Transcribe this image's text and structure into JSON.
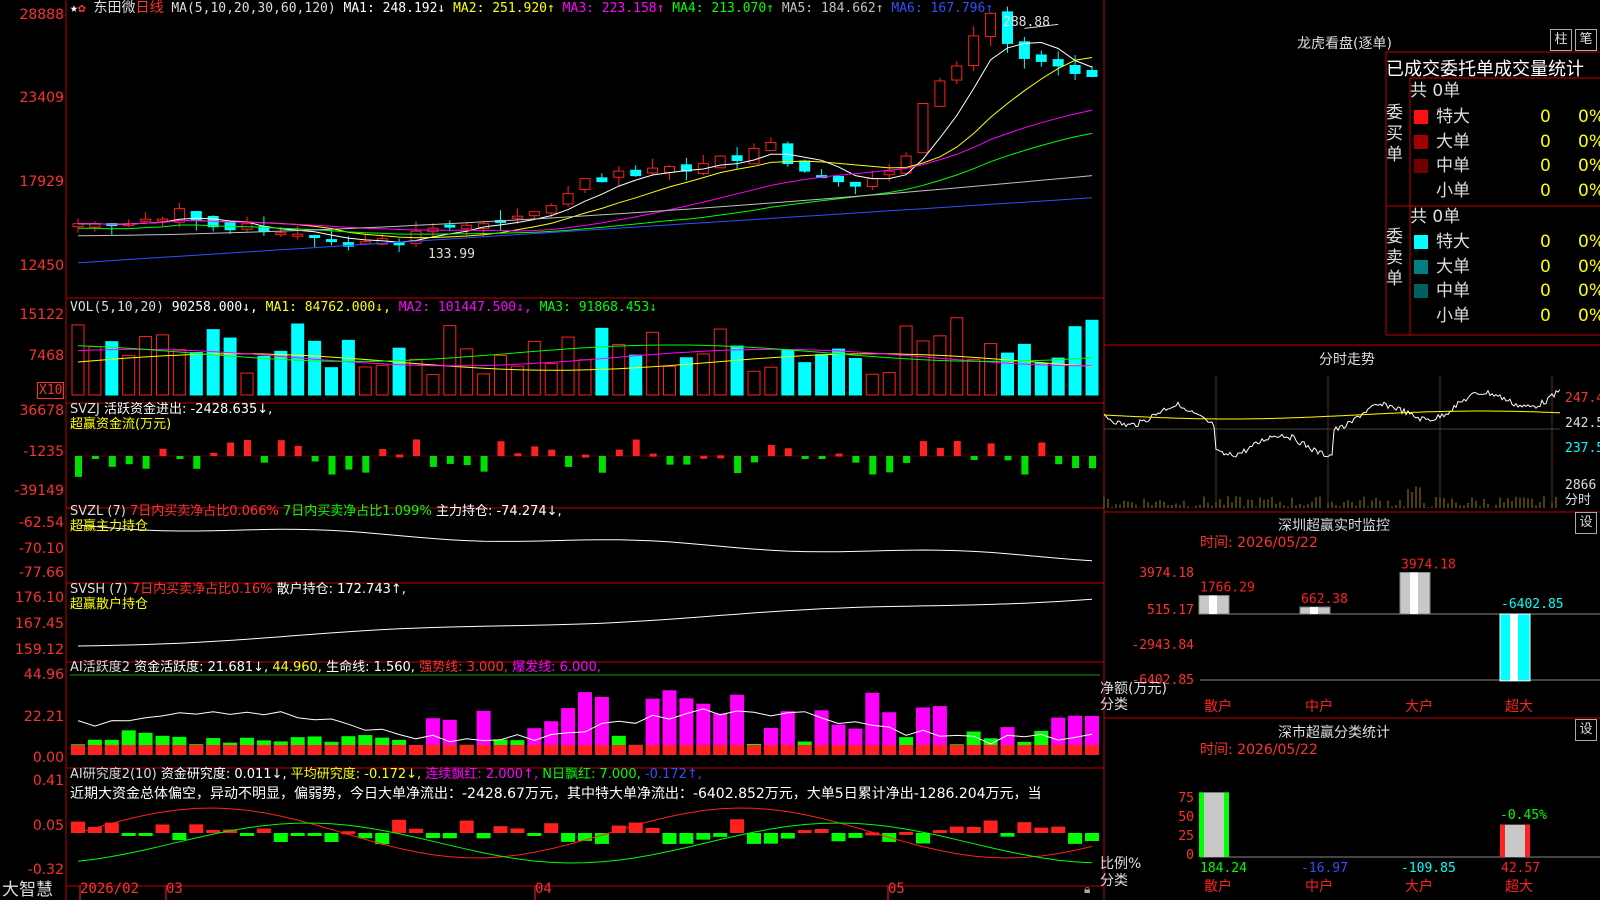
{
  "colors": {
    "up": "#ff2020",
    "down": "#00ffff",
    "green": "#00ff00",
    "magenta": "#ff00ff",
    "yellow": "#ffff00",
    "white": "#ffffff",
    "blue": "#3050ff",
    "gray": "#c0c0c0"
  },
  "kline": {
    "header": {
      "stock": "东田微",
      "period": "日线",
      "ma_label": "MA(5,10,20,30,60,120)",
      "ma1": "MA1: 248.192↓",
      "ma2": "MA2: 251.920↑",
      "ma3": "MA3: 223.158↑",
      "ma4": "MA4: 213.070↑",
      "ma5": "MA5: 184.662↑",
      "ma6": "MA6: 167.796↑"
    },
    "yticks": [
      "28888",
      "23409",
      "17929",
      "12450"
    ],
    "annot_high": "288.88",
    "annot_low": "133.99"
  },
  "vol": {
    "label": "VOL(5,10,20)",
    "val": "90258.000↓,",
    "ma1": "MA1: 84762.000↓,",
    "ma2": "MA2: 101447.500↓,",
    "ma3": "MA3: 91868.453↓",
    "yticks": [
      "15122",
      "7468"
    ],
    "unit": "X10"
  },
  "svzj": {
    "label": "SVZJ",
    "text": "活跃资金进出: -2428.635↓,",
    "sub": "超赢资金流(万元)",
    "yticks": [
      "36678",
      "-1235",
      "-39149"
    ]
  },
  "svzl": {
    "label": "SVZL (7)",
    "t1": "7日内买卖净占比0.066%",
    "t2": "7日内买卖净占比1.099%",
    "t3": "主力持仓: -74.274↓,",
    "sub": "超赢主力持仓",
    "yticks": [
      "-62.54",
      "-70.10",
      "-77.66"
    ]
  },
  "svsh": {
    "label": "SVSH (7)",
    "t1": "7日内买卖净占比0.16%",
    "t2": "散户持仓: 172.743↑,",
    "sub": "超赢散户持仓",
    "yticks": [
      "176.10",
      "167.45",
      "159.12"
    ]
  },
  "ai2": {
    "label": "AI活跃度2",
    "t1": "资金活跃度: 21.681↓,",
    "t2": "44.960,",
    "t3": "生命线: 1.560,",
    "t4": "强势线: 3.000,",
    "t5": "爆发线: 6.000,",
    "yticks": [
      "44.96",
      "22.21",
      "0.00"
    ]
  },
  "ai_res": {
    "label": "AI研究度2(10)",
    "t1": "资金研究度: 0.011↓,",
    "t2": "平均研究度: -0.172↓,",
    "t3": "连续飘红: 2.000↑,",
    "t4": "N日飘红: 7.000,",
    "t5": "-0.172↑,",
    "text": "近期大资金总体偏空，异动不明显，偏弱势，今日大单净流出：-2428.67万元，其中特大单净流出：-6402.852万元，大单5日累计净出-1286.204万元，当",
    "yticks": [
      "0.41",
      "0.05",
      "-0.32"
    ]
  },
  "xaxis": {
    "labels": [
      "2026/02",
      "03",
      "04",
      "05"
    ],
    "brand": "大智慧"
  },
  "lhb": {
    "title": "龙虎看盘(逐单)",
    "btn1": "柱",
    "btn2": "笔",
    "subtitle": "已成交委托单成交量统计",
    "buy": {
      "group": "委买单",
      "total": "共 0单",
      "rows": [
        {
          "name": "特大",
          "qty": "0",
          "pct": "0%"
        },
        {
          "name": "大单",
          "qty": "0",
          "pct": "0%"
        },
        {
          "name": "中单",
          "qty": "0",
          "pct": "0%"
        },
        {
          "name": "小单",
          "qty": "0",
          "pct": "0%"
        }
      ]
    },
    "sell": {
      "group": "委卖单",
      "total": "共 0单",
      "rows": [
        {
          "name": "特大",
          "qty": "0",
          "pct": "0%"
        },
        {
          "name": "大单",
          "qty": "0",
          "pct": "0%"
        },
        {
          "name": "中单",
          "qty": "0",
          "pct": "0%"
        },
        {
          "name": "小单",
          "qty": "0",
          "pct": "0%"
        }
      ]
    }
  },
  "intraday": {
    "title": "分时走势",
    "yticks": [
      "247.4",
      "242.5",
      "237.5"
    ],
    "vol_tick": "2866",
    "unit": "分时"
  },
  "monitor": {
    "title": "深圳超赢实时监控",
    "btn": "设",
    "date": "时间: 2026/05/22",
    "yticks": [
      "3974.18",
      "515.17",
      "-2943.84",
      "-6402.85"
    ],
    "ylabel": "净额(万元)",
    "xlabel": "分类",
    "bars": [
      {
        "cat": "散户",
        "value": 1766.29,
        "label": "1766.29"
      },
      {
        "cat": "中户",
        "value": 662.38,
        "label": "662.38"
      },
      {
        "cat": "大户",
        "value": 3974.18,
        "label": "3974.18"
      },
      {
        "cat": "超大",
        "value": -6402.85,
        "label": "-6402.85"
      }
    ]
  },
  "cls": {
    "title": "深市超赢分类统计",
    "btn": "设",
    "date": "时间: 2026/05/22",
    "yticks": [
      "75",
      "50",
      "25",
      "0"
    ],
    "ylabel": "比例%",
    "xlabel": "分类",
    "pct_label": "-0.45%",
    "bars": [
      {
        "cat": "散户",
        "value": 184.24,
        "label": "184.24"
      },
      {
        "cat": "中户",
        "value": -16.97,
        "label": "-16.97"
      },
      {
        "cat": "大户",
        "value": -109.85,
        "label": "-109.85"
      },
      {
        "cat": "超大",
        "value": 42.57,
        "label": "42.57"
      }
    ]
  },
  "chart_data": {
    "type": "bar",
    "title": "深圳超赢实时监控",
    "ylabel": "净额(万元)",
    "categories": [
      "散户",
      "中户",
      "大户",
      "超大"
    ],
    "values": [
      1766.29,
      662.38,
      3974.18,
      -6402.85
    ],
    "ylim": [
      -6402.85,
      3974.18
    ]
  }
}
